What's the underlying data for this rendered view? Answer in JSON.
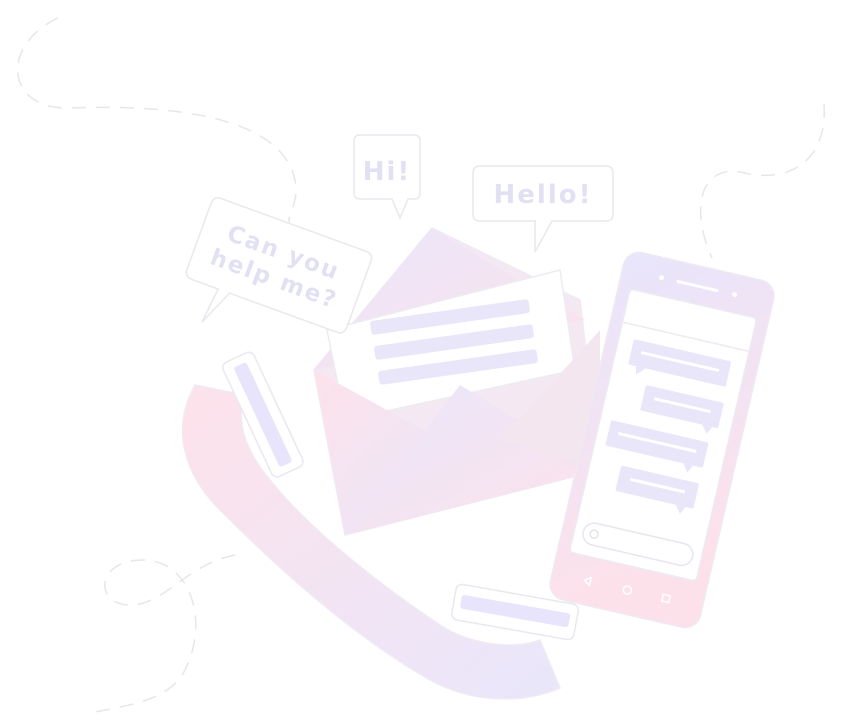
{
  "bubbles": {
    "hi": "Hi!",
    "hello": "Hello!",
    "help_line1": "Can you",
    "help_line2": "help me?"
  },
  "colors": {
    "pink": "#fbe3ec",
    "lavender": "#e6e4fb",
    "bar": "#e9e6fa",
    "outline": "#ececf2",
    "dash": "#e7e7ec",
    "text": "#e2e1f3"
  },
  "icons": {
    "phone_nav": [
      "back-triangle-icon",
      "home-circle-icon",
      "recents-square-icon"
    ]
  }
}
